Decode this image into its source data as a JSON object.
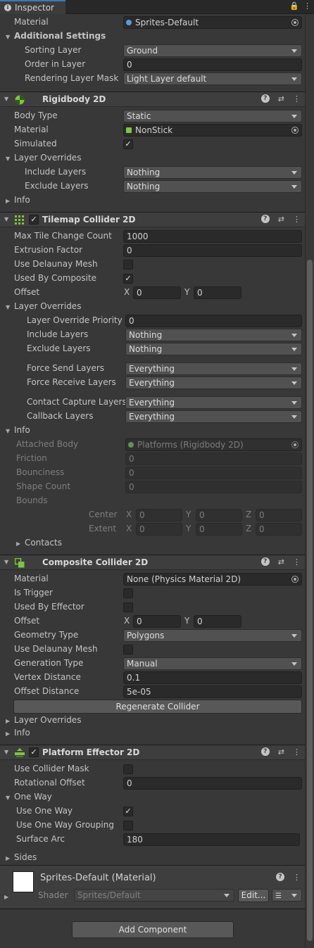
{
  "window": {
    "tab_title": "Inspector",
    "lock_icon": "lock-icon",
    "menu_icon": "kebab-menu-icon"
  },
  "renderer": {
    "material_label": "Material",
    "material_value": "Sprites-Default",
    "additional_settings": "Additional Settings",
    "sorting_layer_label": "Sorting Layer",
    "sorting_layer_value": "Ground",
    "order_label": "Order in Layer",
    "order_value": "0",
    "rlm_label": "Rendering Layer Mask",
    "rlm_value": "Light Layer default"
  },
  "rigidbody": {
    "title": "Rigidbody 2D",
    "body_type_label": "Body Type",
    "body_type_value": "Static",
    "material_label": "Material",
    "material_value": "NonStick",
    "simulated_label": "Simulated",
    "layer_overrides": "Layer Overrides",
    "include_label": "Include Layers",
    "include_value": "Nothing",
    "exclude_label": "Exclude Layers",
    "exclude_value": "Nothing",
    "info": "Info"
  },
  "tilemap": {
    "title": "Tilemap Collider 2D",
    "max_tile_label": "Max Tile Change Count",
    "max_tile_value": "1000",
    "extrusion_label": "Extrusion Factor",
    "extrusion_value": "0",
    "delaunay_label": "Use Delaunay Mesh",
    "composite_label": "Used By Composite",
    "offset_label": "Offset",
    "offset_x": "0",
    "offset_y": "0",
    "x": "X",
    "y": "Y",
    "z": "Z",
    "layer_overrides": "Layer Overrides",
    "priority_label": "Layer Override Priority",
    "priority_value": "0",
    "include_label": "Include Layers",
    "include_value": "Nothing",
    "exclude_label": "Exclude Layers",
    "exclude_value": "Nothing",
    "force_send_label": "Force Send Layers",
    "force_send_value": "Everything",
    "force_receive_label": "Force Receive Layers",
    "force_receive_value": "Everything",
    "contact_label": "Contact Capture Layers",
    "contact_value": "Everything",
    "callback_label": "Callback Layers",
    "callback_value": "Everything",
    "info": "Info",
    "attached_label": "Attached Body",
    "attached_value": "Platforms (Rigidbody 2D)",
    "friction_label": "Friction",
    "friction_value": "0",
    "bounciness_label": "Bounciness",
    "bounciness_value": "0",
    "shape_label": "Shape Count",
    "shape_value": "0",
    "bounds_label": "Bounds",
    "center_label": "Center",
    "extent_label": "Extent",
    "cx": "0",
    "cy": "0",
    "cz": "0",
    "ex": "0",
    "ey": "0",
    "ez": "0",
    "contacts": "Contacts"
  },
  "composite": {
    "title": "Composite Collider 2D",
    "material_label": "Material",
    "material_value": "None (Physics Material 2D)",
    "trigger_label": "Is Trigger",
    "effector_label": "Used By Effector",
    "offset_label": "Offset",
    "offset_x": "0",
    "offset_y": "0",
    "geometry_label": "Geometry Type",
    "geometry_value": "Polygons",
    "delaunay_label": "Use Delaunay Mesh",
    "generation_label": "Generation Type",
    "generation_value": "Manual",
    "vertex_label": "Vertex Distance",
    "vertex_value": "0.1",
    "offset_dist_label": "Offset Distance",
    "offset_dist_value": "5e-05",
    "regenerate": "Regenerate Collider",
    "layer_overrides": "Layer Overrides",
    "info": "Info"
  },
  "effector": {
    "title": "Platform Effector 2D",
    "mask_label": "Use Collider Mask",
    "rot_label": "Rotational Offset",
    "rot_value": "0",
    "oneway": "One Way",
    "use_oneway_label": "Use One Way",
    "grouping_label": "Use One Way Grouping",
    "arc_label": "Surface Arc",
    "arc_value": "180",
    "sides": "Sides"
  },
  "material_preview": {
    "title": "Sprites-Default (Material)",
    "shader_label": "Shader",
    "shader_value": "Sprites/Default",
    "edit": "Edit..."
  },
  "add_component": "Add Component",
  "colors": {
    "accent": "#3a79bb",
    "bg": "#383838",
    "header": "#3e3e3e",
    "field": "#2a2a2a"
  }
}
